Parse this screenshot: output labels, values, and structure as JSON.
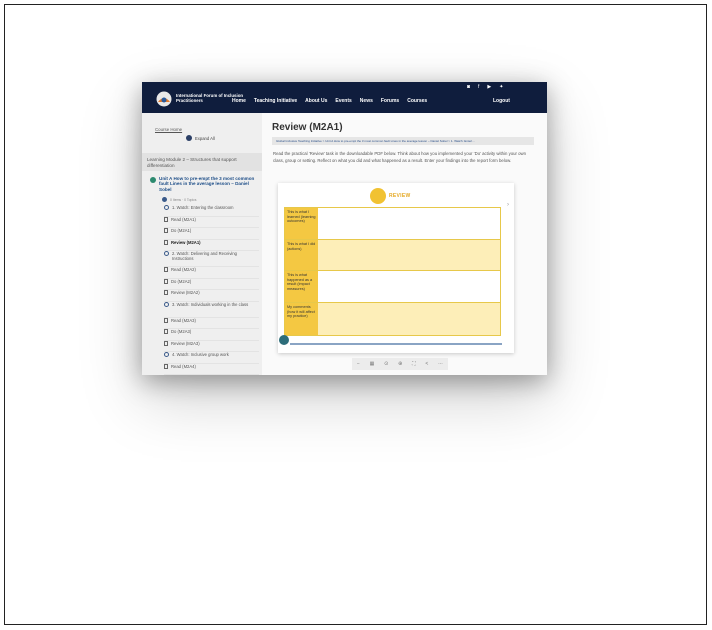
{
  "header": {
    "brand": "International Forum of Inclusion Practitioners",
    "nav": [
      "Home",
      "Teaching Initiative",
      "About Us",
      "Events",
      "News",
      "Forums",
      "Courses"
    ],
    "logout": "Logout",
    "social_icons": [
      "instagram-icon",
      "facebook-icon",
      "youtube-icon",
      "twitter-icon"
    ]
  },
  "sidebar": {
    "course_home": "Course Home",
    "expand_all": "Expand All",
    "module": "Learning Module 2 – Structures that support differentiation",
    "unit": "Unit A How to pre-empt the 3 most common fault Lines in the average lesson – Daniel Sobel",
    "progress": "0 Items · 0 Topics",
    "lessons": [
      {
        "label": "1. Watch: Entering the classroom",
        "icon": "circle",
        "tall": false
      },
      {
        "label": "Read (M2A1)",
        "icon": "doc",
        "tall": false
      },
      {
        "label": "Do (M2A1)",
        "icon": "doc",
        "tall": false
      },
      {
        "label": "Review (M2A1)",
        "icon": "doc",
        "tall": false,
        "active": true
      },
      {
        "label": "2. Watch: Delivering and Receiving Instructions",
        "icon": "circle",
        "tall": true
      },
      {
        "label": "Read (M2A2)",
        "icon": "doc",
        "tall": false
      },
      {
        "label": "Do (M2A2)",
        "icon": "doc",
        "tall": false
      },
      {
        "label": "Review (M2A2)",
        "icon": "doc",
        "tall": false
      },
      {
        "label": "3. Watch: Individuals working in the class",
        "icon": "circle",
        "tall": true
      },
      {
        "label": "Read (M2A3)",
        "icon": "doc",
        "tall": false
      },
      {
        "label": "Do (M2A3)",
        "icon": "doc",
        "tall": false
      },
      {
        "label": "Review (M2A3)",
        "icon": "doc",
        "tall": false
      },
      {
        "label": "4. Watch: Inclusive group work",
        "icon": "circle",
        "tall": false
      },
      {
        "label": "Read (M2A4)",
        "icon": "doc",
        "tall": false
      }
    ]
  },
  "main": {
    "title": "Review (M2A1)",
    "breadcrumb": "Global Inclusive Teaching Initiative > Unit A How to pre-empt the 3 most common fault Lines in the average lesson – Daniel Sobel > 1. Watch: Enteri...",
    "description": "Read the practical ‘Review’ task in the downloadable PDF below. Think about how you implemented your ‘Do’ activity within your own class, group or setting. Reflect on what you did and what happened as a result. Enter your findings into the report form below.",
    "viewer": {
      "heading": "REVIEW",
      "rows": [
        "This is what I learned (learning outcomes)",
        "This is what I did (actions)",
        "This is what happened as a result (impact measures)",
        "My comments (how it will affect my practice)"
      ]
    }
  },
  "colors": {
    "nav_bg": "#0f1d3d",
    "accent_yellow": "#f4c842",
    "link_blue": "#1f4f89"
  }
}
